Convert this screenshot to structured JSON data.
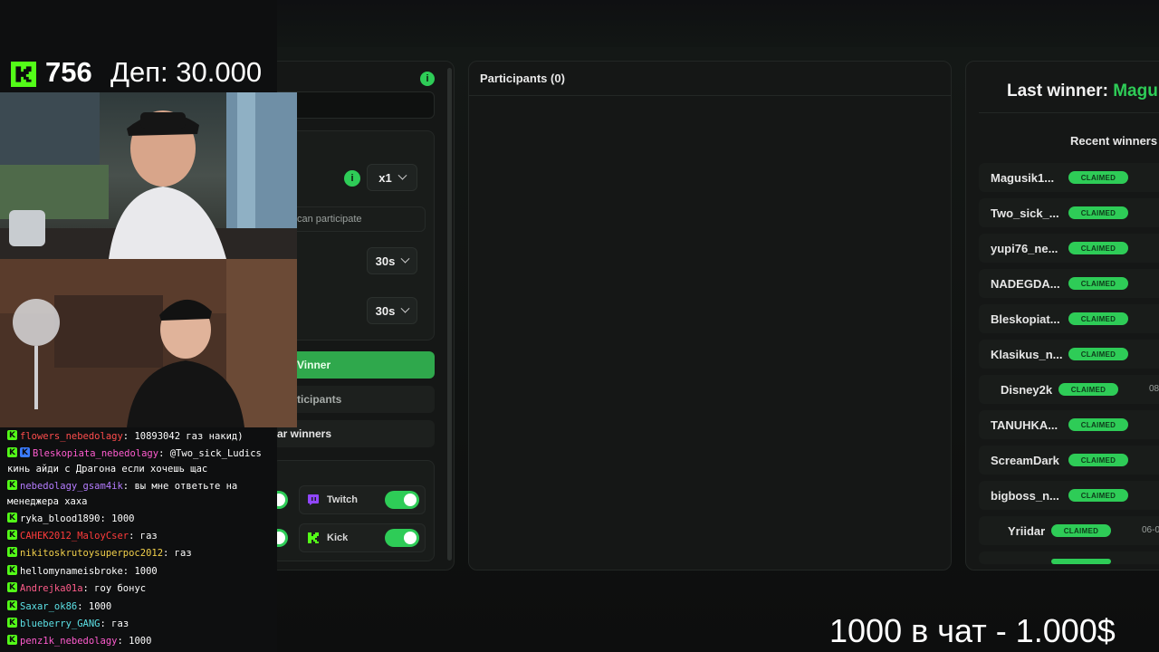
{
  "overlay": {
    "viewer_count": "756",
    "deposit_text": "Деп: 30.000",
    "bottom_text": "1000 в чат  - 1.000$"
  },
  "settings": {
    "multiplier": "x1",
    "participate_text": "can participate",
    "timer1": "30s",
    "timer2": "30s",
    "pick_winner_label": "Vinner",
    "participants_btn_label": "ticipants",
    "clear_winners_label": "ar winners",
    "platforms": [
      {
        "name": "Twitch",
        "enabled": true
      },
      {
        "name": "Kick",
        "enabled": true
      }
    ],
    "colors": {
      "accent": "#2ecc57",
      "twitch": "#9146ff",
      "kick": "#53fc18"
    }
  },
  "participants": {
    "title": "Participants (0)"
  },
  "winners": {
    "last_winner_label": "Last winner:",
    "last_winner_name": "Magu",
    "recent_title": "Recent winners",
    "claimed_label": "CLAIMED",
    "rows": [
      {
        "name": "Magusik1...",
        "date": ""
      },
      {
        "name": "Two_sick_...",
        "date": ""
      },
      {
        "name": "yupi76_ne...",
        "date": ""
      },
      {
        "name": "NADEGDA...",
        "date": ""
      },
      {
        "name": "Bleskopiat...",
        "date": ""
      },
      {
        "name": "Klasikus_n...",
        "date": ""
      },
      {
        "name": "Disney2k",
        "date": "08"
      },
      {
        "name": "TANUHKA...",
        "date": ""
      },
      {
        "name": "ScreamDark",
        "date": ""
      },
      {
        "name": "bigboss_n...",
        "date": ""
      },
      {
        "name": "Yriidar",
        "date": "06-0"
      }
    ]
  },
  "chat": [
    {
      "user": "flowers_nebedolagy",
      "color": "#ff4d4d",
      "msg": "10893042 газ накид)",
      "extra_badge": false
    },
    {
      "user": "Bleskopiata_nebedolagy",
      "color": "#ff5ccf",
      "msg": "@Two_sick_Ludics кинь айди с Драгона если хочешь щас",
      "extra_badge": true
    },
    {
      "user": "nebedolagy_gsam4ik",
      "color": "#b57cff",
      "msg": "вы мне ответьте на менеджера хаха",
      "extra_badge": false
    },
    {
      "user": "ryka_blood1890",
      "color": "#ffffff",
      "msg": "1000",
      "extra_badge": false
    },
    {
      "user": "CAHEK2012_MaloyCser",
      "color": "#ff3b3b",
      "msg": "газ",
      "extra_badge": false
    },
    {
      "user": "nikitoskrutoysuperpoc2012",
      "color": "#f2d04b",
      "msg": "газ",
      "extra_badge": false
    },
    {
      "user": "hellomynameisbroke",
      "color": "#ffffff",
      "msg": "1000",
      "extra_badge": false
    },
    {
      "user": "Andrejka01a",
      "color": "#ff5c8a",
      "msg": "гоу бонус",
      "extra_badge": false
    },
    {
      "user": "Saxar_ok86",
      "color": "#5ce1e6",
      "msg": "1000",
      "extra_badge": false
    },
    {
      "user": "blueberry_GANG",
      "color": "#5ce1e6",
      "msg": "газ",
      "extra_badge": false
    },
    {
      "user": "penz1k_nebedolagy",
      "color": "#ff5ccf",
      "msg": "1000",
      "extra_badge": false
    }
  ]
}
